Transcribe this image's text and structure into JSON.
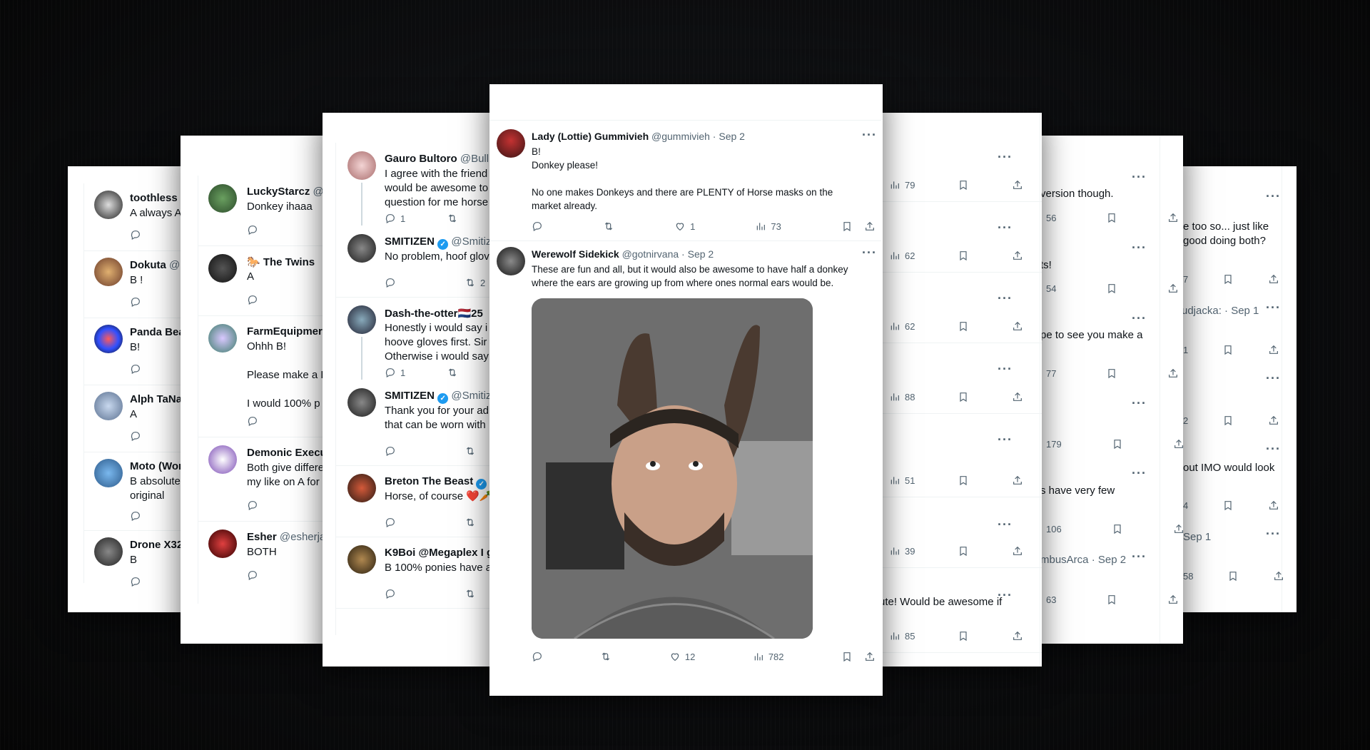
{
  "panel1": {
    "tweets": [
      {
        "name": "toothless l",
        "text": "A always A"
      },
      {
        "name": "Dokuta",
        "handle": "@D",
        "text": "B !"
      },
      {
        "name": "Panda Bea",
        "text": "B!"
      },
      {
        "name": "Alph TaNa",
        "text": "A"
      },
      {
        "name": "Moto (Wor",
        "text": "B absolute\noriginal"
      },
      {
        "name": "Drone X32",
        "text": "B"
      }
    ]
  },
  "panel2": {
    "tweets": [
      {
        "name": "LuckyStarcz",
        "handle": "@",
        "text": "Donkey ihaaa"
      },
      {
        "name": "🐎 The Twins",
        "text": "A"
      },
      {
        "name": "FarmEquipmer",
        "text": "Ohhh B!\n\nPlease make a D\n\nI would 100% p"
      },
      {
        "name": "Demonic Execu",
        "text": "Both give differe\nmy like on A for"
      },
      {
        "name": "Esher",
        "handle": "@esherja",
        "text": "BOTH"
      }
    ]
  },
  "panel3": {
    "tweets": [
      {
        "name": "Gauro Bultoro",
        "handle": "@Bull",
        "text": "I agree with the friend\nwould be awesome to\nquestion for me horse",
        "reply": "1"
      },
      {
        "name": "SMITIZEN",
        "handle": "@Smitiz",
        "text": "No problem, hoof glov",
        "retweet": "2"
      },
      {
        "name": "Dash-the-otter🇳🇱25",
        "text": "Honestly i would say i\nhoove gloves first. Sir\nOtherwise i would say",
        "reply": "1"
      },
      {
        "name": "SMITIZEN",
        "handle": "@Smitiz",
        "text": "Thank you for your ad\nthat can be worn with"
      },
      {
        "name": "Breton The Beast",
        "text": "Horse, of course ❤️🥕"
      },
      {
        "name": "K9Boi @Megaplex I g",
        "text": "B 100% ponies have a"
      }
    ]
  },
  "center": {
    "tweet1": {
      "name": "Lady (Lottie) Gummivieh",
      "handle": "@gummivieh · Sep 2",
      "text": "B!\nDonkey please!\n\nNo one makes Donkeys and there are PLENTY of Horse masks on the\nmarket already.",
      "likes": "1",
      "views": "73"
    },
    "tweet2": {
      "name": "Werewolf Sidekick",
      "handle": "@gotnirvana · Sep 2",
      "text": "These are fun and all, but it would also be awesome to have half a donkey\nwhere the ears are growing up from where ones normal ears would be.",
      "likes": "12",
      "views": "782"
    }
  },
  "panel5": {
    "views": [
      "79",
      "62",
      "62",
      "88",
      "51",
      "39",
      "85"
    ],
    "snippet": "ute! Would be awesome if"
  },
  "panel6": {
    "snippets": [
      "version though.",
      "ts!",
      "pe to see you make a",
      "",
      "s have very few",
      ""
    ],
    "handle_line": "mbusArca · Sep 2",
    "views": [
      "56",
      "54",
      "77",
      "179",
      "106",
      "63"
    ]
  },
  "panel7": {
    "snippets": [
      "e too so... just like\ngood doing both?",
      "udjacka: · Sep 1",
      "",
      "out IMO would look",
      "Sep 1"
    ],
    "views": [
      "7",
      "1",
      "2",
      "4",
      "58"
    ]
  },
  "icons": {
    "reply": "reply-icon",
    "retweet": "retweet-icon",
    "like": "heart-icon",
    "views": "views-icon",
    "bookmark": "bookmark-icon",
    "share": "share-icon",
    "more": "more-icon"
  }
}
